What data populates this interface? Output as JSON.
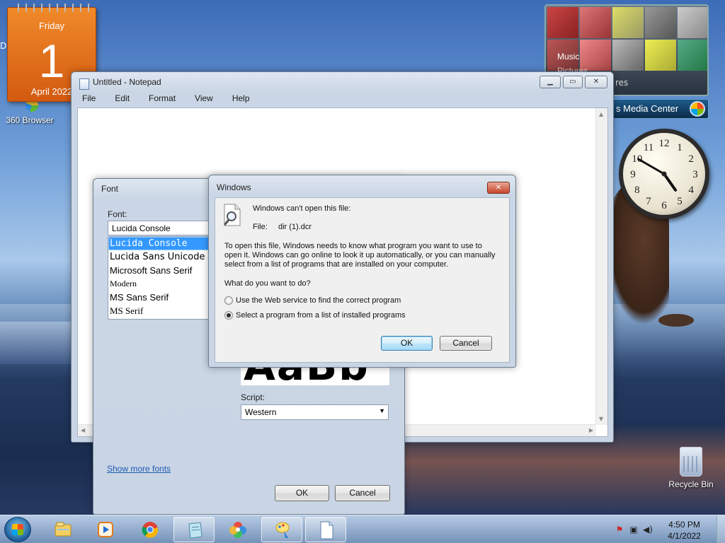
{
  "desktop": {
    "left_tag": "D",
    "icons": {
      "browser_360": "360 Browser",
      "recycle_bin": "Recycle Bin"
    }
  },
  "calendar_gadget": {
    "weekday": "Friday",
    "day": "1",
    "month_year": "April 2022"
  },
  "media_center_gadget": {
    "menu": [
      "Music",
      "Pictures"
    ],
    "partial_item": "res",
    "title": "s Media Center",
    "accent": "#1d5c8c"
  },
  "clock_gadget": {
    "numbers": [
      "12",
      "1",
      "2",
      "3",
      "4",
      "5",
      "6",
      "7",
      "8",
      "9",
      "10",
      "11"
    ],
    "time_shown": "4:50"
  },
  "notepad": {
    "title": "Untitled - Notepad",
    "menu": [
      "File",
      "Edit",
      "Format",
      "View",
      "Help"
    ],
    "content": ""
  },
  "font_dialog": {
    "title": "Font",
    "font_label": "Font:",
    "font_value": "Lucida Console",
    "font_list": [
      "Lucida Console",
      "Lucida Sans Unicode",
      "Microsoft Sans Serif",
      "Modern",
      "MS Sans Serif",
      "MS Serif"
    ],
    "selected_index": 0,
    "sample_text": "AaBb",
    "script_label": "Script:",
    "script_value": "Western",
    "show_more_link": "Show more fonts",
    "ok_label": "OK",
    "cancel_label": "Cancel"
  },
  "alert_dialog": {
    "title": "Windows",
    "heading": "Windows can't open this file:",
    "file_label": "File:",
    "file_name": "dir (1).dcr",
    "description_lines": [
      "To open this file, Windows needs to know what program you want to use to",
      "open it. Windows can go online to look it up automatically, or you can manually",
      "select from a list of programs that are installed on your computer."
    ],
    "question": "What do you want to do?",
    "options": [
      {
        "label": "Use the Web service to find the correct program",
        "selected": false
      },
      {
        "label": "Select a program from a list of installed programs",
        "selected": true
      }
    ],
    "ok_label": "OK",
    "cancel_label": "Cancel"
  },
  "taskbar": {
    "items": [
      "explorer-icon",
      "media-player-icon",
      "chrome-icon",
      "notepad-icon",
      "photo-app-icon",
      "paint-icon",
      "document-icon"
    ],
    "time": "4:50 PM",
    "date": "4/1/2022"
  }
}
